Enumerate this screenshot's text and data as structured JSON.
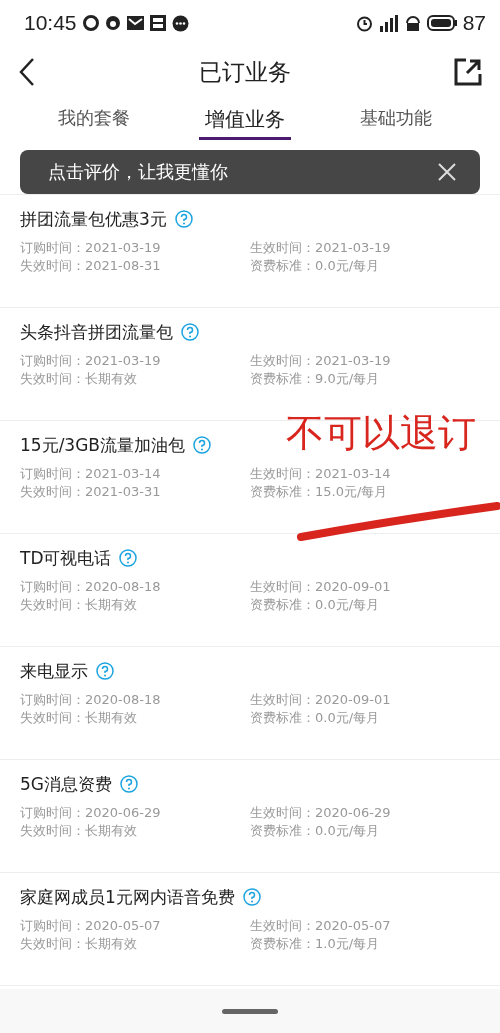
{
  "status_bar": {
    "time": "10:45",
    "battery": "87"
  },
  "header": {
    "title": "已订业务"
  },
  "tabs": [
    {
      "label": "我的套餐",
      "selected": false
    },
    {
      "label": "增值业务",
      "selected": true
    },
    {
      "label": "基础功能",
      "selected": false
    }
  ],
  "toast": {
    "text": "点击评价，让我更懂你"
  },
  "services": [
    {
      "name": "拼团流量包优惠3元",
      "order_time": "订购时间：2021-03-19",
      "effective_time": "生效时间：2021-03-19",
      "expire_time": "失效时间：2021-08-31",
      "fee": "资费标准：0.0元/每月"
    },
    {
      "name": "头条抖音拼团流量包",
      "order_time": "订购时间：2021-03-19",
      "effective_time": "生效时间：2021-03-19",
      "expire_time": "失效时间：长期有效",
      "fee": "资费标准：9.0元/每月"
    },
    {
      "name": "15元/3GB流量加油包",
      "order_time": "订购时间：2021-03-14",
      "effective_time": "生效时间：2021-03-14",
      "expire_time": "失效时间：2021-03-31",
      "fee": "资费标准：15.0元/每月"
    },
    {
      "name": "TD可视电话",
      "order_time": "订购时间：2020-08-18",
      "effective_time": "生效时间：2020-09-01",
      "expire_time": "失效时间：长期有效",
      "fee": "资费标准：0.0元/每月"
    },
    {
      "name": "来电显示",
      "order_time": "订购时间：2020-08-18",
      "effective_time": "生效时间：2020-09-01",
      "expire_time": "失效时间：长期有效",
      "fee": "资费标准：0.0元/每月"
    },
    {
      "name": "5G消息资费",
      "order_time": "订购时间：2020-06-29",
      "effective_time": "生效时间：2020-06-29",
      "expire_time": "失效时间：长期有效",
      "fee": "资费标准：0.0元/每月"
    },
    {
      "name": "家庭网成员1元网内语音免费",
      "order_time": "订购时间：2020-05-07",
      "effective_time": "生效时间：2020-05-07",
      "expire_time": "失效时间：长期有效",
      "fee": "资费标准：1.0元/每月"
    }
  ],
  "annotation": {
    "text": "不可以退订"
  }
}
